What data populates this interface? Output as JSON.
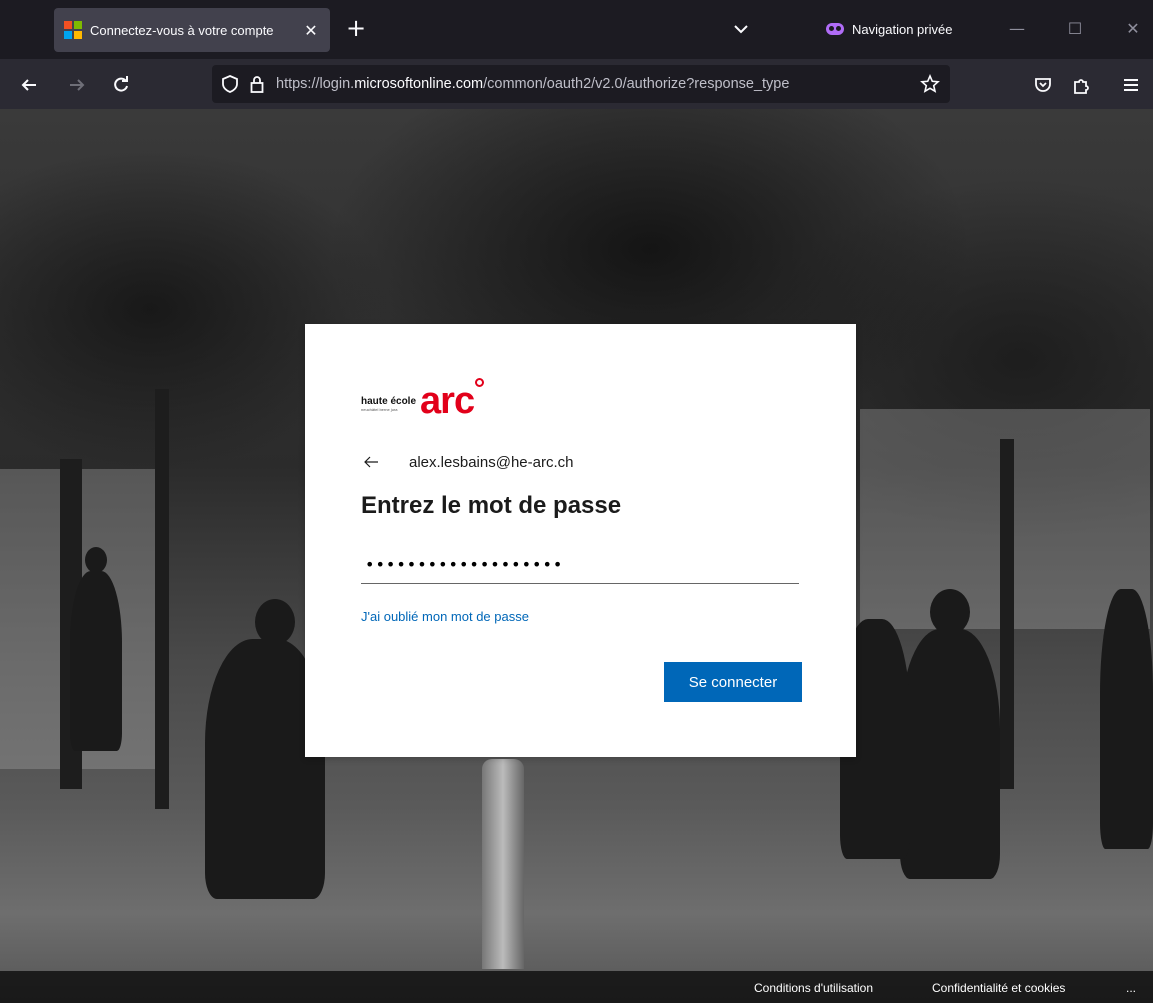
{
  "browser": {
    "tab": {
      "title": "Connectez-vous à votre compte",
      "close_label": "✕",
      "favicon": "microsoft-logo",
      "favicon_colors": [
        "#f25022",
        "#7fba00",
        "#00a4ef",
        "#ffb900"
      ]
    },
    "new_tab_label": "+",
    "private_label": "Navigation privée",
    "private_color": "#b06cf7",
    "window_controls": {
      "minimize": "—",
      "maximize": "☐",
      "close": "✕"
    },
    "url": {
      "prefix": "https://login.",
      "domain": "microsoftonline.com",
      "path": "/common/oauth2/v2.0/authorize?response_type"
    }
  },
  "login": {
    "logo": {
      "line1": "haute école",
      "line2": "neuchâtel berne jura",
      "brand": "arc",
      "brand_color": "#e2001a"
    },
    "back_icon": "arrow-left",
    "email": "alex.lesbains@he-arc.ch",
    "heading": "Entrez le mot de passe",
    "password_masked": "•••••••••••••••••••",
    "forgot_link": "J'ai oublié mon mot de passe",
    "submit_label": "Se connecter",
    "accent_color": "#0067b8"
  },
  "footer": {
    "terms": "Conditions d'utilisation",
    "privacy": "Confidentialité et cookies",
    "more": "..."
  }
}
